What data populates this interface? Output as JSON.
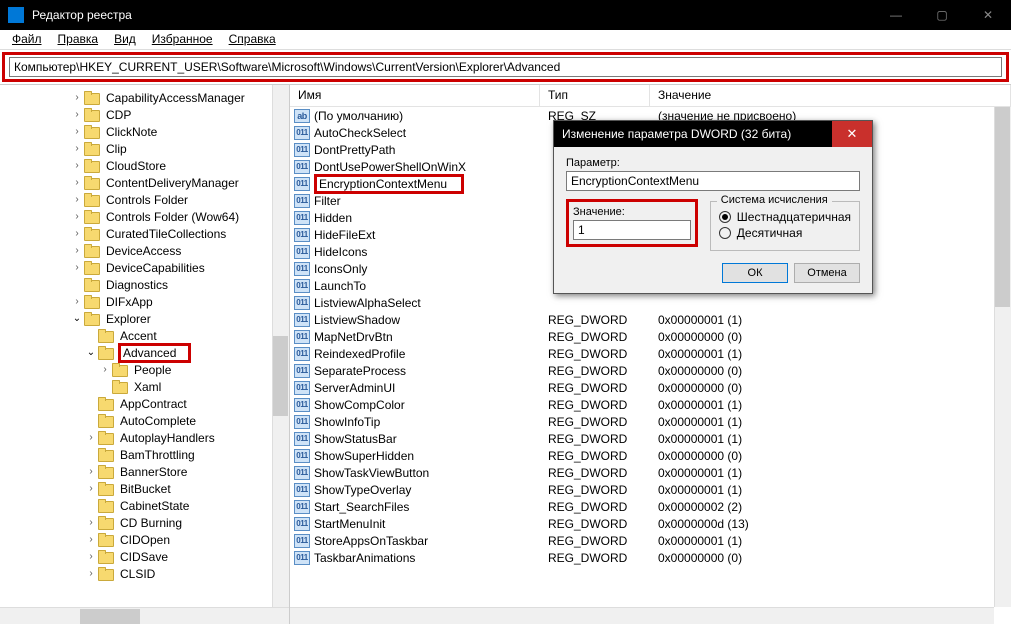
{
  "window_title": "Редактор реестра",
  "menu": {
    "file": "Файл",
    "edit": "Правка",
    "view": "Вид",
    "fav": "Избранное",
    "help": "Справка"
  },
  "address": "Компьютер\\HKEY_CURRENT_USER\\Software\\Microsoft\\Windows\\CurrentVersion\\Explorer\\Advanced",
  "columns": {
    "name": "Имя",
    "type": "Тип",
    "value": "Значение"
  },
  "tree_indent_base": 60,
  "tree": [
    {
      "label": "CapabilityAccessManager",
      "indent": 5,
      "chev": ">"
    },
    {
      "label": "CDP",
      "indent": 5,
      "chev": ">"
    },
    {
      "label": "ClickNote",
      "indent": 5,
      "chev": ">"
    },
    {
      "label": "Clip",
      "indent": 5,
      "chev": ">"
    },
    {
      "label": "CloudStore",
      "indent": 5,
      "chev": ">"
    },
    {
      "label": "ContentDeliveryManager",
      "indent": 5,
      "chev": ">"
    },
    {
      "label": "Controls Folder",
      "indent": 5,
      "chev": ">"
    },
    {
      "label": "Controls Folder (Wow64)",
      "indent": 5,
      "chev": ">"
    },
    {
      "label": "CuratedTileCollections",
      "indent": 5,
      "chev": ">"
    },
    {
      "label": "DeviceAccess",
      "indent": 5,
      "chev": ">"
    },
    {
      "label": "DeviceCapabilities",
      "indent": 5,
      "chev": ">"
    },
    {
      "label": "Diagnostics",
      "indent": 5,
      "chev": ""
    },
    {
      "label": "DIFxApp",
      "indent": 5,
      "chev": ">"
    },
    {
      "label": "Explorer",
      "indent": 5,
      "chev": "v"
    },
    {
      "label": "Accent",
      "indent": 6,
      "chev": ""
    },
    {
      "label": "Advanced",
      "indent": 6,
      "chev": "v",
      "highlight": true
    },
    {
      "label": "People",
      "indent": 7,
      "chev": ">"
    },
    {
      "label": "Xaml",
      "indent": 7,
      "chev": ""
    },
    {
      "label": "AppContract",
      "indent": 6,
      "chev": ""
    },
    {
      "label": "AutoComplete",
      "indent": 6,
      "chev": ""
    },
    {
      "label": "AutoplayHandlers",
      "indent": 6,
      "chev": ">"
    },
    {
      "label": "BamThrottling",
      "indent": 6,
      "chev": ""
    },
    {
      "label": "BannerStore",
      "indent": 6,
      "chev": ">"
    },
    {
      "label": "BitBucket",
      "indent": 6,
      "chev": ">"
    },
    {
      "label": "CabinetState",
      "indent": 6,
      "chev": ""
    },
    {
      "label": "CD Burning",
      "indent": 6,
      "chev": ">"
    },
    {
      "label": "CIDOpen",
      "indent": 6,
      "chev": ">"
    },
    {
      "label": "CIDSave",
      "indent": 6,
      "chev": ">"
    },
    {
      "label": "CLSID",
      "indent": 6,
      "chev": ">"
    }
  ],
  "rows": [
    {
      "name": "(По умолчанию)",
      "type": "REG_SZ",
      "value": "(значение не присвоено)",
      "icon": "ab"
    },
    {
      "name": "AutoCheckSelect",
      "type": "",
      "value": "",
      "icon": "011"
    },
    {
      "name": "DontPrettyPath",
      "type": "",
      "value": "",
      "icon": "011"
    },
    {
      "name": "DontUsePowerShellOnWinX",
      "type": "",
      "value": "",
      "icon": "011"
    },
    {
      "name": "EncryptionContextMenu",
      "type": "",
      "value": "",
      "icon": "011",
      "highlight": true
    },
    {
      "name": "Filter",
      "type": "",
      "value": "",
      "icon": "011"
    },
    {
      "name": "Hidden",
      "type": "",
      "value": "",
      "icon": "011"
    },
    {
      "name": "HideFileExt",
      "type": "",
      "value": "",
      "icon": "011"
    },
    {
      "name": "HideIcons",
      "type": "",
      "value": "",
      "icon": "011"
    },
    {
      "name": "IconsOnly",
      "type": "",
      "value": "",
      "icon": "011"
    },
    {
      "name": "LaunchTo",
      "type": "",
      "value": "",
      "icon": "011"
    },
    {
      "name": "ListviewAlphaSelect",
      "type": "",
      "value": "",
      "icon": "011"
    },
    {
      "name": "ListviewShadow",
      "type": "REG_DWORD",
      "value": "0x00000001 (1)",
      "icon": "011"
    },
    {
      "name": "MapNetDrvBtn",
      "type": "REG_DWORD",
      "value": "0x00000000 (0)",
      "icon": "011"
    },
    {
      "name": "ReindexedProfile",
      "type": "REG_DWORD",
      "value": "0x00000001 (1)",
      "icon": "011"
    },
    {
      "name": "SeparateProcess",
      "type": "REG_DWORD",
      "value": "0x00000000 (0)",
      "icon": "011"
    },
    {
      "name": "ServerAdminUI",
      "type": "REG_DWORD",
      "value": "0x00000000 (0)",
      "icon": "011"
    },
    {
      "name": "ShowCompColor",
      "type": "REG_DWORD",
      "value": "0x00000001 (1)",
      "icon": "011"
    },
    {
      "name": "ShowInfoTip",
      "type": "REG_DWORD",
      "value": "0x00000001 (1)",
      "icon": "011"
    },
    {
      "name": "ShowStatusBar",
      "type": "REG_DWORD",
      "value": "0x00000001 (1)",
      "icon": "011"
    },
    {
      "name": "ShowSuperHidden",
      "type": "REG_DWORD",
      "value": "0x00000000 (0)",
      "icon": "011"
    },
    {
      "name": "ShowTaskViewButton",
      "type": "REG_DWORD",
      "value": "0x00000001 (1)",
      "icon": "011"
    },
    {
      "name": "ShowTypeOverlay",
      "type": "REG_DWORD",
      "value": "0x00000001 (1)",
      "icon": "011"
    },
    {
      "name": "Start_SearchFiles",
      "type": "REG_DWORD",
      "value": "0x00000002 (2)",
      "icon": "011"
    },
    {
      "name": "StartMenuInit",
      "type": "REG_DWORD",
      "value": "0x0000000d (13)",
      "icon": "011"
    },
    {
      "name": "StoreAppsOnTaskbar",
      "type": "REG_DWORD",
      "value": "0x00000001 (1)",
      "icon": "011"
    },
    {
      "name": "TaskbarAnimations",
      "type": "REG_DWORD",
      "value": "0x00000000 (0)",
      "icon": "011"
    }
  ],
  "dialog": {
    "title": "Изменение параметра DWORD (32 бита)",
    "param_label": "Параметр:",
    "param_value": "EncryptionContextMenu",
    "value_label": "Значение:",
    "value_value": "1",
    "radix_legend": "Система исчисления",
    "hex": "Шестнадцатеричная",
    "dec": "Десятичная",
    "ok": "ОК",
    "cancel": "Отмена"
  }
}
